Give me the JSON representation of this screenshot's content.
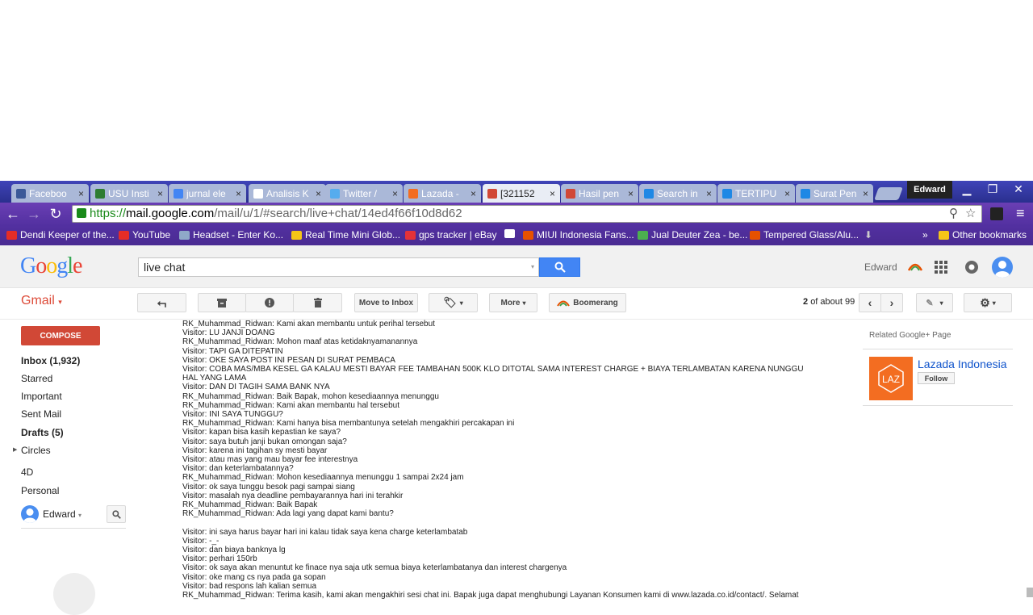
{
  "browser": {
    "tabs": [
      {
        "label": "Faceboo",
        "icon": "facebook-icon",
        "color": "#3b5998"
      },
      {
        "label": "USU Insti",
        "icon": "usu-icon",
        "color": "#2e7d32"
      },
      {
        "label": "jurnal ele",
        "icon": "google-icon",
        "color": "#4285f4"
      },
      {
        "label": "Analisis K",
        "icon": "document-icon",
        "color": "#ffffff"
      },
      {
        "label": "Twitter /",
        "icon": "twitter-icon",
        "color": "#55acee"
      },
      {
        "label": "Lazada -",
        "icon": "lazada-icon",
        "color": "#f36d21"
      },
      {
        "label": "[321152",
        "icon": "gmail-icon",
        "color": "#d14836",
        "active": true
      },
      {
        "label": "Hasil pen",
        "icon": "gmail-icon",
        "color": "#d14836"
      },
      {
        "label": "Search in",
        "icon": "kaskus-icon",
        "color": "#1e88e5"
      },
      {
        "label": "TERTIPU",
        "icon": "kaskus-icon",
        "color": "#1e88e5"
      },
      {
        "label": "Surat Pen",
        "icon": "kaskus-icon",
        "color": "#1e88e5"
      }
    ],
    "close_glyph": "×",
    "profile_name": "Edward",
    "url_scheme": "https://",
    "url_host": "mail.google.com",
    "url_path": "/mail/u/1/#search/live+chat/14ed4f66f10d8d62",
    "bookmarks": [
      {
        "label": "Dendi Keeper of the...",
        "color": "#e52d27"
      },
      {
        "label": "YouTube",
        "color": "#e52d27"
      },
      {
        "label": "Headset - Enter Ko...",
        "color": "#8fa8c8"
      },
      {
        "label": "Real Time Mini Glob...",
        "color": "#f5c518"
      },
      {
        "label": "gps tracker | eBay",
        "color": "#e53238"
      },
      {
        "label": "",
        "color": "#ffffff"
      },
      {
        "label": "MIUI Indonesia Fans...",
        "color": "#e65100"
      },
      {
        "label": "Jual Deuter Zea - be...",
        "color": "#4caf50"
      },
      {
        "label": "Tempered Glass/Alu...",
        "color": "#e65100"
      }
    ],
    "more_bookmarks": "»",
    "other_bookmarks": "Other bookmarks"
  },
  "gmail": {
    "search_value": "live chat",
    "account_name": "Edward",
    "app_label": "Gmail",
    "move_to_inbox": "Move to Inbox",
    "more_label": "More",
    "boomerang_label": "Boomerang",
    "pager_range": "2",
    "pager_rest": "of about 99",
    "compose_label": "COMPOSE",
    "nav": [
      {
        "label": "Inbox (1,932)",
        "bold": true
      },
      {
        "label": "Starred"
      },
      {
        "label": "Important"
      },
      {
        "label": "Sent Mail"
      },
      {
        "label": "Drafts (5)",
        "bold": true
      },
      {
        "label": "Circles"
      },
      {
        "label": "4D"
      },
      {
        "label": "Personal"
      }
    ],
    "hangout_user": "Edward",
    "related_title": "Related Google+ Page",
    "page_name": "Lazada Indonesia",
    "follow_label": "Follow",
    "laz_logo": "LAZ"
  },
  "message_lines": [
    "RK_Muhammad_Ridwan: Kami akan membantu untuk perihal tersebut",
    "Visitor: LU JANJI DOANG",
    "RK_Muhammad_Ridwan: Mohon maaf atas ketidaknyamanannya",
    "Visitor: TAPI GA DITEPATIN",
    "Visitor: OKE SAYA POST INI PESAN DI SURAT PEMBACA",
    "Visitor: COBA MAS/MBA KESEL GA KALAU MESTI BAYAR FEE TAMBAHAN 500K KLO DITOTAL SAMA INTEREST CHARGE + BIAYA TERLAMBATAN KARENA NUNGGU",
    "HAL YANG LAMA",
    "Visitor: DAN DI TAGIH SAMA BANK NYA",
    "RK_Muhammad_Ridwan: Baik Bapak, mohon kesediaannya menunggu",
    "RK_Muhammad_Ridwan: Kami akan membantu hal tersebut",
    "Visitor: INI SAYA TUNGGU?",
    "RK_Muhammad_Ridwan: Kami hanya bisa membantunya setelah mengakhiri percakapan ini",
    "Visitor: kapan bisa kasih kepastian ke saya?",
    "Visitor: saya butuh janji bukan omongan saja?",
    "Visitor: karena ini tagihan sy mesti bayar",
    "Visitor: atau mas yang mau bayar fee interestnya",
    "Visitor: dan keterlambatannya?",
    "RK_Muhammad_Ridwan: Mohon kesediaannya menunggu 1 sampai 2x24 jam",
    "Visitor: ok saya tunggu besok pagi sampai siang",
    "Visitor: masalah nya deadline pembayarannya hari ini terahkir",
    "RK_Muhammad_Ridwan: Baik Bapak",
    "RK_Muhammad_Ridwan: Ada lagi yang dapat kami bantu?",
    "",
    "Visitor: ini saya harus bayar hari ini kalau tidak saya kena charge keterlambatab",
    "Visitor: -_-",
    "Visitor: dan biaya banknya lg",
    "Visitor: perhari 150rb",
    "Visitor: ok saya akan menuntut ke finace nya saja utk semua biaya keterlambatanya dan interest chargenya",
    "Visitor: oke mang cs nya pada ga sopan",
    "Visitor: bad respons lah kalian semua",
    "RK_Muhammad_Ridwan: Terima kasih, kami akan mengakhiri sesi chat ini. Bapak juga dapat menghubungi Layanan Konsumen kami di www.lazada.co.id/contact/. Selamat"
  ],
  "colors": {
    "gmail_red": "#dd4b39",
    "compose_red": "#d14836",
    "search_blue": "#4285f4",
    "chrome_tab_strip": "#2d3a9e",
    "chrome_toolbar": "#5a34a0",
    "lazada_orange": "#f36d21",
    "link_blue": "#1155cc"
  }
}
